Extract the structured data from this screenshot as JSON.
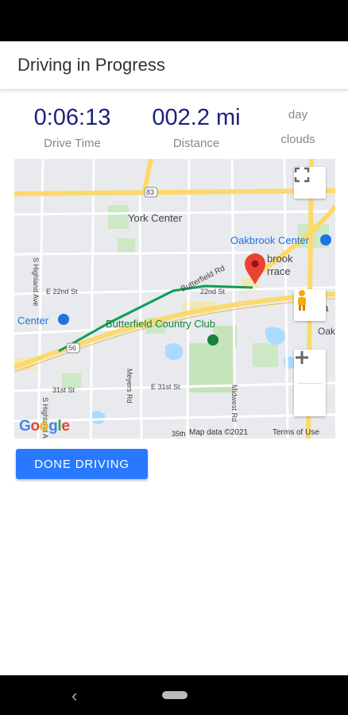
{
  "app_bar": {
    "title": "Driving in Progress"
  },
  "stats": {
    "drive_time": {
      "value": "0:06:13",
      "label": "Drive Time"
    },
    "distance": {
      "value": "002.2 mi",
      "label": "Distance"
    },
    "weather": {
      "time_of_day": "day",
      "condition": "clouds"
    }
  },
  "map": {
    "labels": {
      "york_center": "York Center",
      "oakbrook_center": "Oakbrook Center",
      "oakbrook_terrace_1": "brook",
      "oakbrook_terrace_2": "rrace",
      "butterfield_rd": "Butterfield Rd",
      "center": "Center",
      "butterfield_country_club": "Butterfield Country Club",
      "oak_bro": "Oak Bro",
      "oak_o": "Oa",
      "e_22nd": "E 22nd St",
      "rd_22nd": "22nd St",
      "st_31": "31st St",
      "e_31": "E 31st St",
      "meyers": "Meyers Rd",
      "midwest": "Midwest Rd",
      "highland": "S Highland Ave",
      "highland2": "S Highland Ave",
      "route_83": "83",
      "route_56": "56",
      "st_35": "35th"
    },
    "attribution": "Map data ©2021",
    "terms": "Terms of Use",
    "logo": "Google",
    "route_color": "#0f9d58",
    "marker_color": "#ea4335"
  },
  "actions": {
    "done_label": "DONE DRIVING"
  },
  "nav": {
    "back_glyph": "‹"
  }
}
